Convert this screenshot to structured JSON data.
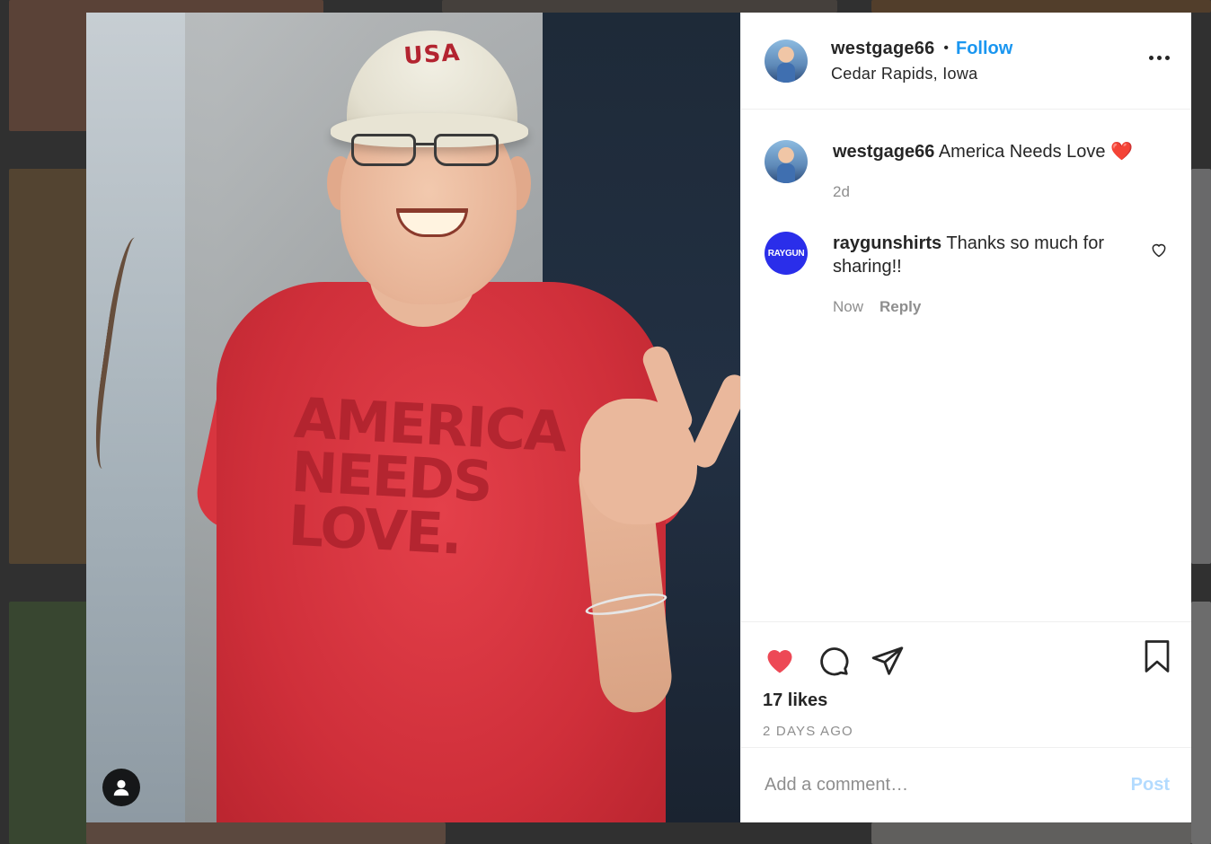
{
  "post": {
    "username": "westgage66",
    "follow_label": "Follow",
    "location": "Cedar Rapids, Iowa",
    "photo": {
      "cap_text": "USA",
      "shirt_text_lines": [
        "AMERICA",
        "NEEDS",
        "LOVE."
      ]
    }
  },
  "comments": [
    {
      "username": "westgage66",
      "text": "America Needs Love ❤️",
      "time": "2d",
      "avatar_icon": "user-photo-avatar"
    },
    {
      "username": "raygunshirts",
      "text": "Thanks so much for sharing!!",
      "time": "Now",
      "reply_label": "Reply",
      "avatar_label": "RAYGUN",
      "avatar_color": "#2a2eea"
    }
  ],
  "actions": {
    "likes": "17 likes",
    "posted_ago": "2 DAYS AGO",
    "like_color": "#ed4956"
  },
  "add_comment": {
    "placeholder": "Add a comment…",
    "post_label": "Post",
    "post_color": "#b3dbff"
  },
  "icons": {
    "more": "more-options-icon",
    "like": "heart-filled-icon",
    "comment": "comment-bubble-icon",
    "share": "share-paper-plane-icon",
    "save": "bookmark-icon",
    "tagged": "tagged-user-icon"
  }
}
